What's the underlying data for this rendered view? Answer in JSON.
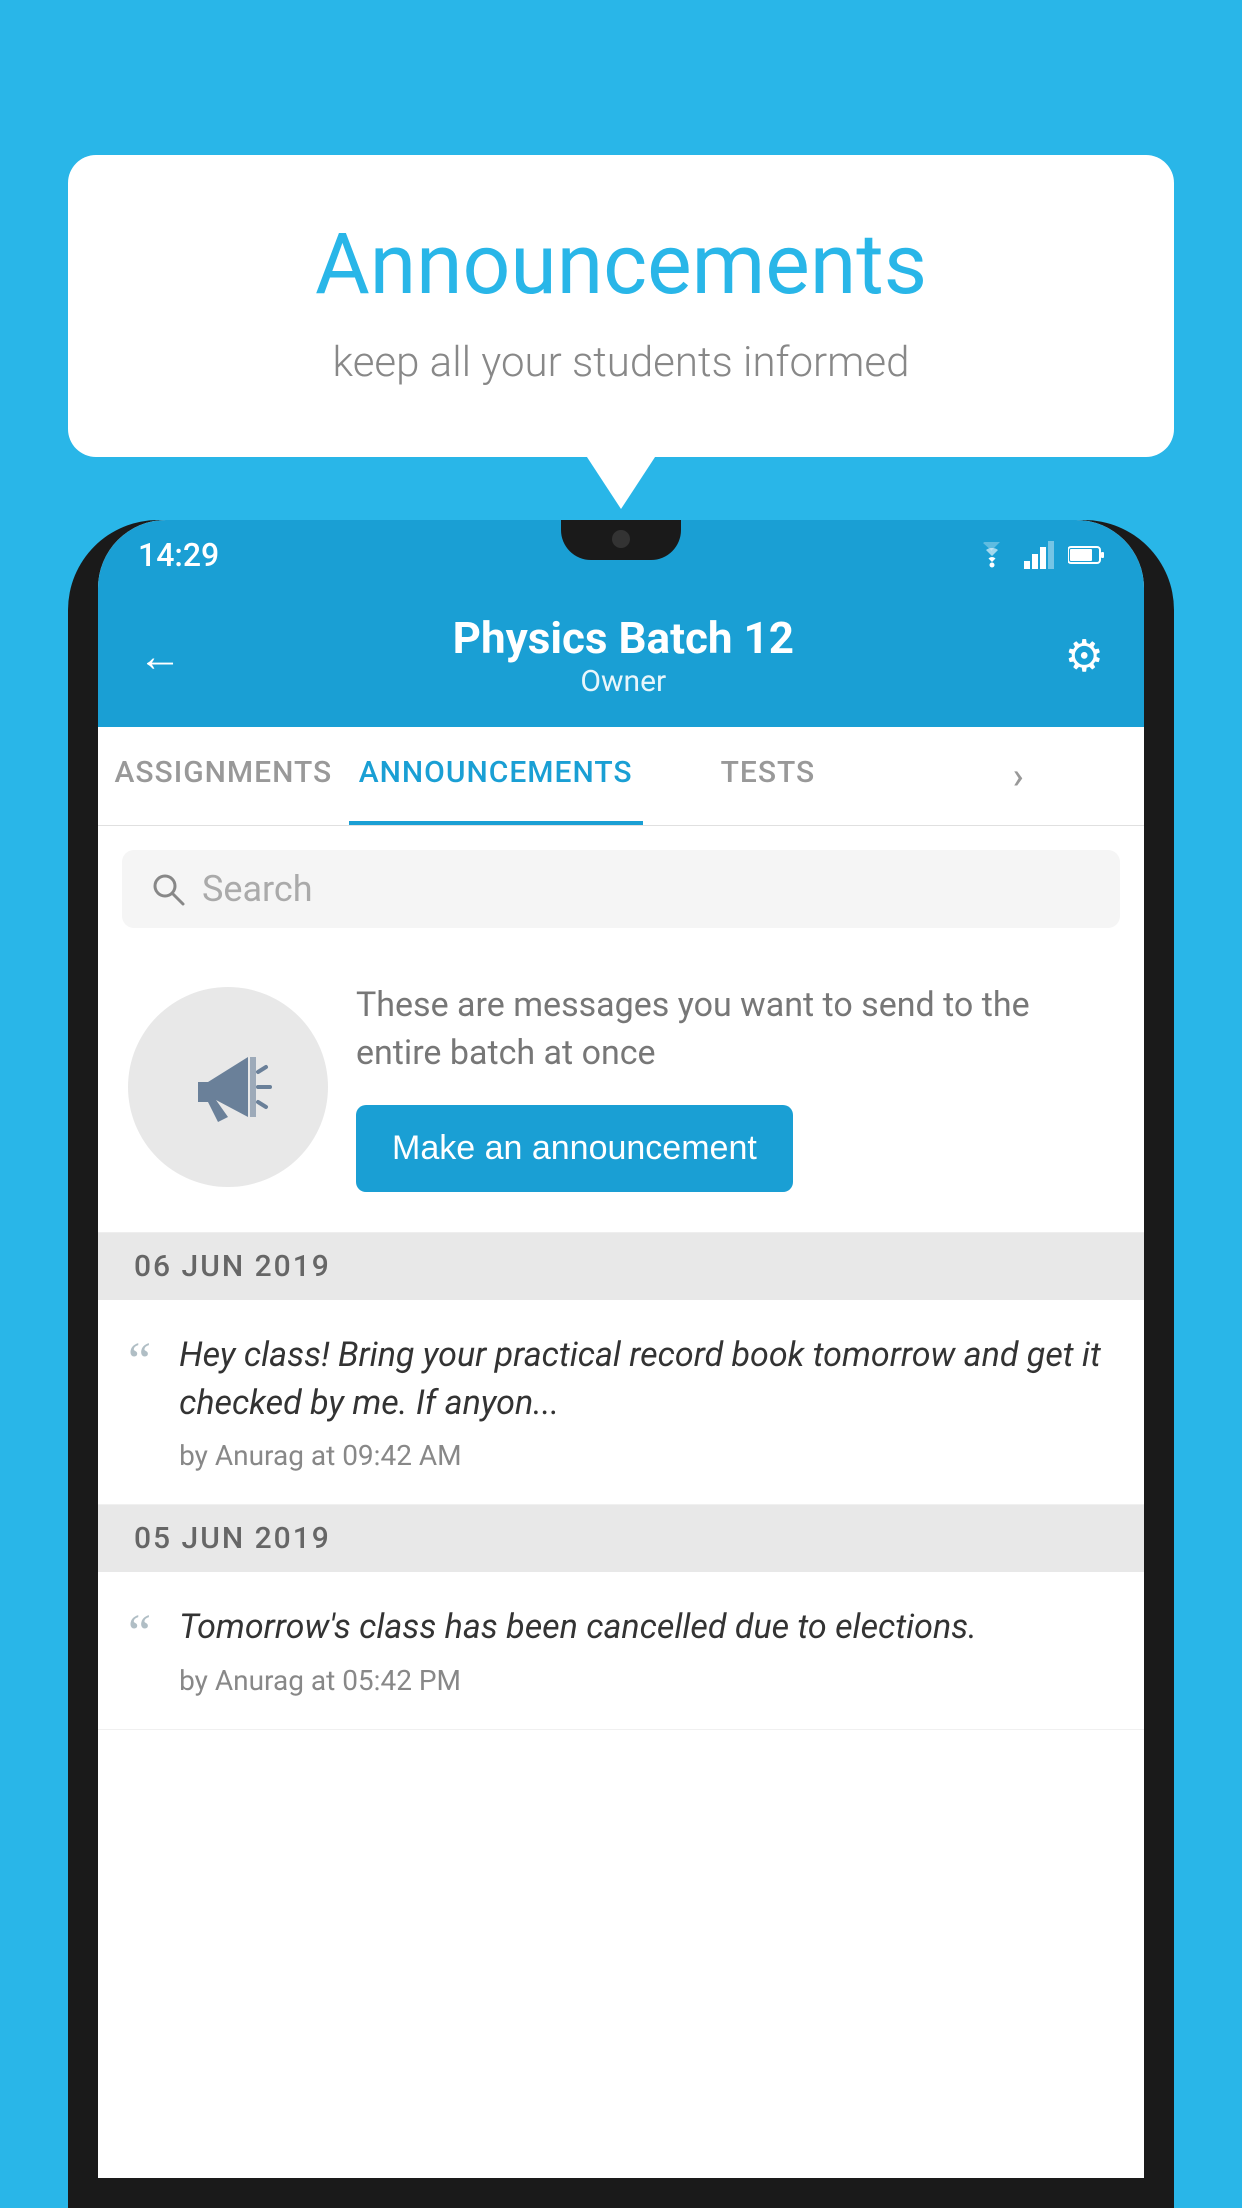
{
  "background_color": "#29b6e8",
  "speech_bubble": {
    "title": "Announcements",
    "subtitle": "keep all your students informed"
  },
  "status_bar": {
    "time": "14:29"
  },
  "app_header": {
    "title": "Physics Batch 12",
    "subtitle": "Owner",
    "back_label": "←"
  },
  "tabs": [
    {
      "label": "ASSIGNMENTS",
      "active": false
    },
    {
      "label": "ANNOUNCEMENTS",
      "active": true
    },
    {
      "label": "TESTS",
      "active": false
    },
    {
      "label": "...",
      "active": false
    }
  ],
  "search": {
    "placeholder": "Search"
  },
  "promo": {
    "text": "These are messages you want to send to the entire batch at once",
    "button_label": "Make an announcement"
  },
  "announcements": [
    {
      "date": "06  JUN  2019",
      "message": "Hey class! Bring your practical record book tomorrow and get it checked by me. If anyon...",
      "author": "by Anurag at 09:42 AM"
    },
    {
      "date": "05  JUN  2019",
      "message": "Tomorrow's class has been cancelled due to elections.",
      "author": "by Anurag at 05:42 PM"
    }
  ]
}
